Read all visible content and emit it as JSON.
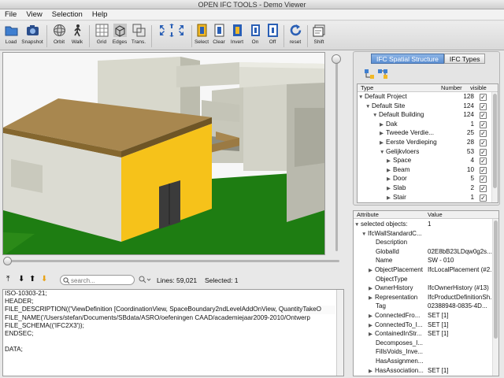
{
  "window": {
    "title": "OPEN IFC TOOLS - Demo Viewer"
  },
  "menu": [
    "File",
    "View",
    "Selection",
    "Help"
  ],
  "toolbar": {
    "load": "Load",
    "snapshot": "Snapshot",
    "orbit": "Orbit",
    "walk": "Walk",
    "grid": "Grid",
    "edges": "Edges",
    "trans": "Trans.",
    "select": "Select",
    "clear": "Clear",
    "invert": "Invert",
    "on": "On",
    "off": "Off",
    "reset": "reset",
    "shift": "Shift"
  },
  "bottom": {
    "search_placeholder": "search...",
    "lines": "Lines: 59,021",
    "selected": "Selected: 1"
  },
  "console_lines": [
    "ISO-10303-21;",
    "HEADER;",
    "FILE_DESCRIPTION(('ViewDefinition [CoordinationView, SpaceBoundary2ndLevelAddOnView, QuantityTakeO",
    "FILE_NAME('/Users/stefan/Documents/SBdata/ASRO/oefeningen CAAD/academiejaar2009-2010/Ontwerp",
    "FILE_SCHEMA(('IFC2X3'));",
    "ENDSEC;",
    "",
    "DATA;"
  ],
  "tabs": {
    "spatial": "IFC Spatial Structure",
    "types": "IFC Types"
  },
  "tree": {
    "headers": {
      "type": "Type",
      "number": "Number",
      "visible": "visible"
    },
    "rows": [
      {
        "label": "Default Project",
        "number": "128",
        "checked": "✓"
      },
      {
        "label": "Default Site",
        "number": "124",
        "checked": "✓"
      },
      {
        "label": "Default Building",
        "number": "124",
        "checked": "✓"
      },
      {
        "label": "Dak",
        "number": "1",
        "checked": "✓"
      },
      {
        "label": "Tweede Verdie...",
        "number": "25",
        "checked": "✓"
      },
      {
        "label": "Eerste Verdieping",
        "number": "28",
        "checked": "✓"
      },
      {
        "label": "Gelijkvloers",
        "number": "53",
        "checked": "✓"
      },
      {
        "label": "Space",
        "number": "4",
        "checked": "✓"
      },
      {
        "label": "Beam",
        "number": "10",
        "checked": "✓"
      },
      {
        "label": "Door",
        "number": "5",
        "checked": "✓"
      },
      {
        "label": "Slab",
        "number": "2",
        "checked": "✓"
      },
      {
        "label": "Stair",
        "number": "1",
        "checked": "✓"
      }
    ]
  },
  "attributes": {
    "headers": {
      "attribute": "Attribute",
      "value": "Value"
    },
    "rows": [
      {
        "name": "selected objects:",
        "value": "1"
      },
      {
        "name": "IfcWallStandardC...",
        "value": ""
      },
      {
        "name": "Description",
        "value": ""
      },
      {
        "name": "GlobalId",
        "value": "02E8bB23LDqw0g2s..."
      },
      {
        "name": "Name",
        "value": "SW - 010"
      },
      {
        "name": "ObjectPlacement",
        "value": "IfcLocalPlacement (#2..."
      },
      {
        "name": "ObjectType",
        "value": ""
      },
      {
        "name": "OwnerHistory",
        "value": "IfcOwnerHistory (#13)"
      },
      {
        "name": "Representation",
        "value": "IfcProductDefinitionSh..."
      },
      {
        "name": "Tag",
        "value": "02388948-0835-4D..."
      },
      {
        "name": "ConnectedFro...",
        "value": "SET [1]"
      },
      {
        "name": "ConnectedTo_I...",
        "value": "SET [1]"
      },
      {
        "name": "ContainedInStr...",
        "value": "SET [1]"
      },
      {
        "name": "Decomposes_I...",
        "value": ""
      },
      {
        "name": "FillsVoids_Inve...",
        "value": ""
      },
      {
        "name": "HasAssignmen...",
        "value": ""
      },
      {
        "name": "HasAssociation...",
        "value": "SET [1]"
      }
    ]
  }
}
